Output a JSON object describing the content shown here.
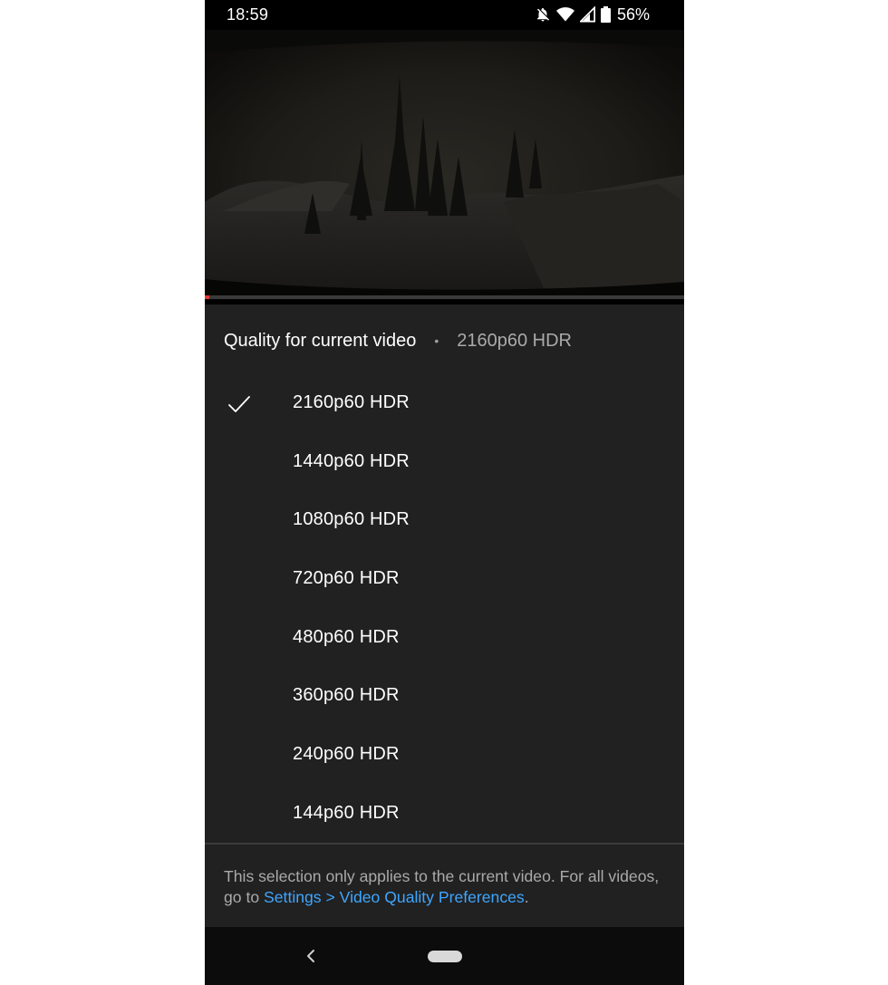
{
  "status_bar": {
    "time": "18:59",
    "battery_percent": "56%",
    "icons": [
      "notifications-off-icon",
      "wifi-icon",
      "cell-signal-icon",
      "battery-icon"
    ]
  },
  "video": {
    "progress_fraction": 0.01,
    "progress_color": "#e53935"
  },
  "quality_sheet": {
    "title": "Quality for current video",
    "separator": "•",
    "current_quality": "2160p60 HDR",
    "options": [
      {
        "label": "2160p60 HDR",
        "selected": true
      },
      {
        "label": "1440p60 HDR",
        "selected": false
      },
      {
        "label": "1080p60 HDR",
        "selected": false
      },
      {
        "label": "720p60 HDR",
        "selected": false
      },
      {
        "label": "480p60 HDR",
        "selected": false
      },
      {
        "label": "360p60 HDR",
        "selected": false
      },
      {
        "label": "240p60 HDR",
        "selected": false
      },
      {
        "label": "144p60 HDR",
        "selected": false
      }
    ],
    "footer_text": "This selection only applies to the current video. For all videos, go to ",
    "footer_link": "Settings > Video Quality Preferences",
    "footer_end": ".",
    "link_color": "#3ea6ff"
  },
  "nav_bar": {
    "icons": [
      "back-icon",
      "home-pill-icon"
    ]
  }
}
